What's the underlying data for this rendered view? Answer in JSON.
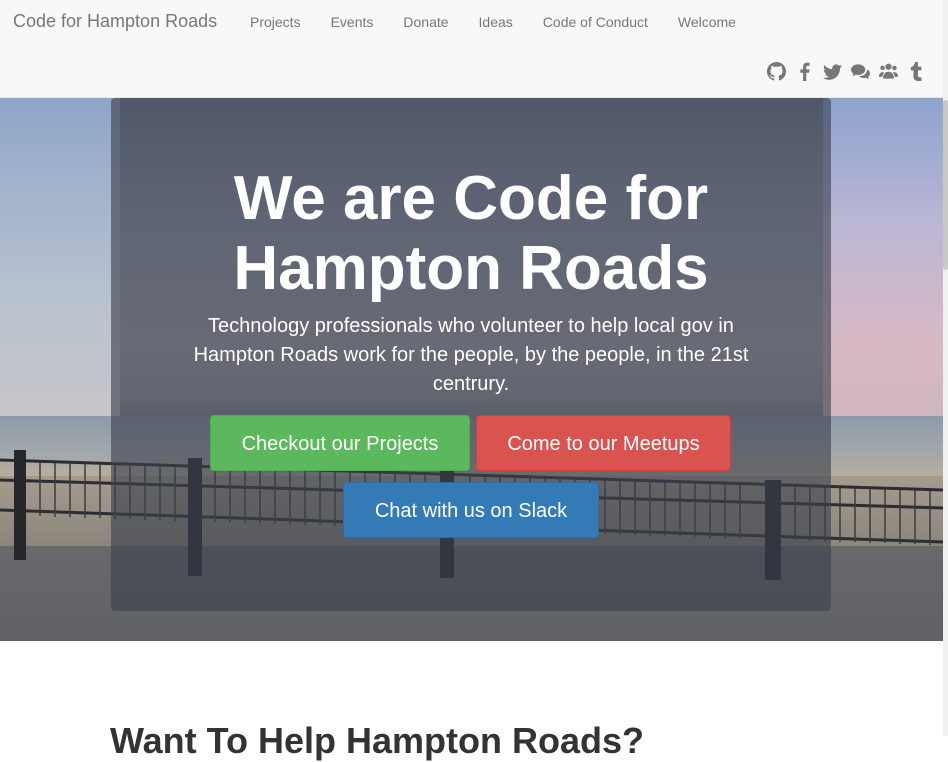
{
  "navbar": {
    "brand": "Code for Hampton Roads",
    "links": [
      "Projects",
      "Events",
      "Donate",
      "Ideas",
      "Code of Conduct",
      "Welcome"
    ],
    "social_icons": [
      "github-icon",
      "facebook-icon",
      "twitter-icon",
      "chat-icon",
      "users-icon",
      "tumblr-icon"
    ],
    "text_color": "#777777",
    "background": "#f8f8f8"
  },
  "hero": {
    "title": "We are Code for Hampton Roads",
    "subtitle": "Technology professionals who volunteer to help local gov in Hampton Roads work for the people, by the people, in the 21st centrury.",
    "buttons": {
      "projects": "Checkout our Projects",
      "meetups": "Come to our Meetups",
      "slack": "Chat with us on Slack"
    },
    "button_colors": {
      "projects": "#5cb85c",
      "meetups": "#d9534f",
      "slack": "#337ab7"
    }
  },
  "section": {
    "heading": "Want To Help Hampton Roads?"
  }
}
